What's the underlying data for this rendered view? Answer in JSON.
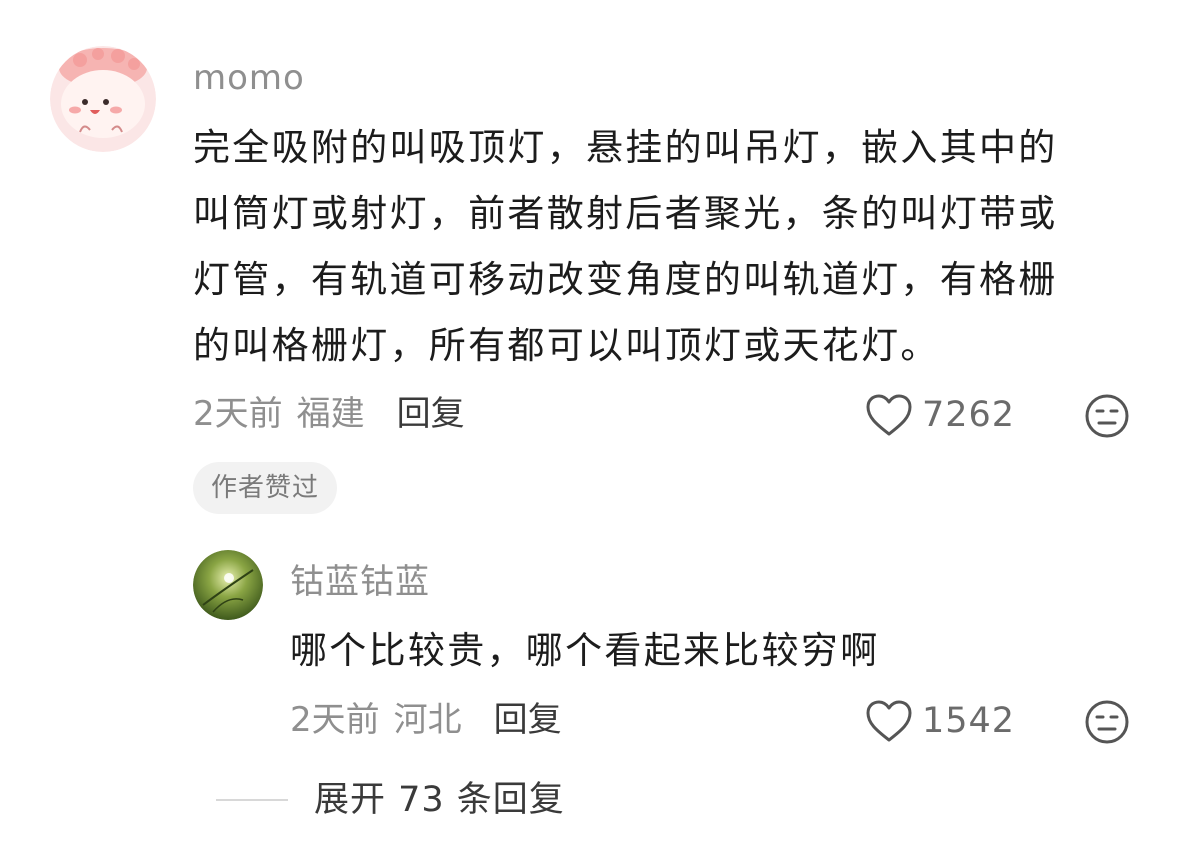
{
  "comment": {
    "username": "momo",
    "text_lines": [
      "完全吸附的叫吸顶灯，悬挂的叫吊灯，嵌入其中的",
      "叫筒灯或射灯，前者散射后者聚光，条的叫灯带或",
      "灯管，有轨道可移动改变角度的叫轨道灯，有格栅",
      "的叫格栅灯，所有都可以叫顶灯或天花灯。"
    ],
    "time": "2天前",
    "location": "福建",
    "reply_label": "回复",
    "like_count": "7262",
    "author_badge": "作者赞过"
  },
  "reply": {
    "username": "钴蓝钴蓝",
    "text": "哪个比较贵，哪个看起来比较穷啊",
    "time": "2天前",
    "location": "河北",
    "reply_label": "回复",
    "like_count": "1542"
  },
  "expand": {
    "label": "展开 73 条回复"
  },
  "icons": {
    "like": "heart-outline-icon",
    "dislike": "meh-face-icon"
  },
  "colors": {
    "username": "#8f8f8f",
    "text": "#1c1c1c",
    "meta": "#8f8f8f",
    "badge_bg": "#f2f2f2"
  }
}
